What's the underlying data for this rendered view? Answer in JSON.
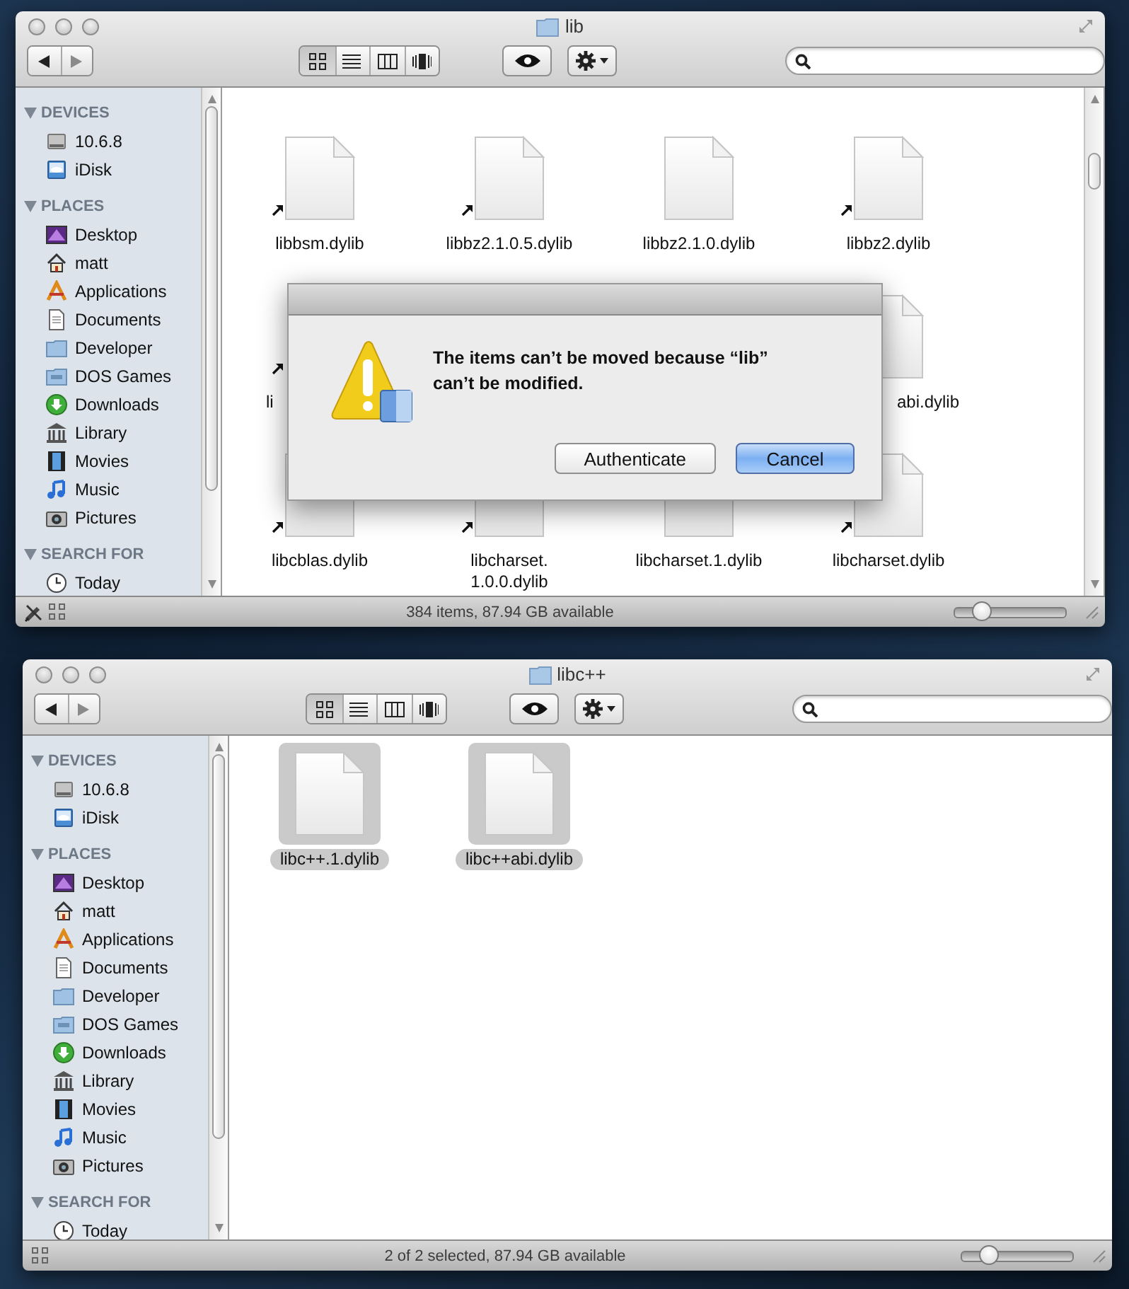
{
  "windows": [
    {
      "title": "lib",
      "scrolled": true,
      "view_modes": [
        {
          "kind": "icon",
          "selected": true
        },
        {
          "kind": "list",
          "selected": false
        },
        {
          "kind": "columns",
          "selected": false
        },
        {
          "kind": "coverflow",
          "selected": false
        }
      ],
      "sidebar": [
        {
          "header": "DEVICES",
          "items": [
            {
              "kind": "disk",
              "label": "10.6.8",
              "selected": false
            },
            {
              "kind": "idisk",
              "label": "iDisk",
              "selected": false
            }
          ]
        },
        {
          "header": "PLACES",
          "items": [
            {
              "kind": "desktop",
              "label": "Desktop",
              "selected": false
            },
            {
              "kind": "home",
              "label": "matt",
              "selected": false
            },
            {
              "kind": "applications",
              "label": "Applications",
              "selected": false
            },
            {
              "kind": "documents",
              "label": "Documents",
              "selected": false
            },
            {
              "kind": "folder",
              "label": "Developer",
              "selected": false
            },
            {
              "kind": "dos-folder",
              "label": "DOS Games",
              "selected": false
            },
            {
              "kind": "downloads",
              "label": "Downloads",
              "selected": false
            },
            {
              "kind": "library",
              "label": "Library",
              "selected": false
            },
            {
              "kind": "movies",
              "label": "Movies",
              "selected": false
            },
            {
              "kind": "music",
              "label": "Music",
              "selected": false
            },
            {
              "kind": "pictures",
              "label": "Pictures",
              "selected": false
            }
          ]
        },
        {
          "header": "SEARCH FOR",
          "items": [
            {
              "kind": "clock",
              "label": "Today",
              "selected": false
            }
          ]
        }
      ],
      "files": [
        [
          {
            "name": "libbsm.dylib",
            "alias": true,
            "selected": false
          },
          {
            "name": "libbz2.1.0.5.dylib",
            "alias": true,
            "selected": false
          },
          {
            "name": "libbz2.1.0.dylib",
            "alias": false,
            "selected": false
          },
          {
            "name": "libbz2.dylib",
            "alias": true,
            "selected": false
          }
        ],
        [
          {
            "name": "li",
            "alias": true,
            "selected": false,
            "covered": true
          },
          {
            "name": "abi.dylib",
            "alias": false,
            "selected": false,
            "covered": true
          }
        ],
        [
          {
            "name": "libcblas.dylib",
            "alias": true,
            "selected": false
          },
          {
            "name": "libcharset.1.0.0.dylib",
            "alias": true,
            "selected": false
          },
          {
            "name": "libcharset.1.dylib",
            "alias": false,
            "selected": false
          },
          {
            "name": "libcharset.dylib",
            "alias": true,
            "selected": false
          }
        ]
      ],
      "status": "384 items, 87.94 GB available",
      "read_only": true,
      "zoom": {
        "level": 0.24
      },
      "alert": {
        "message": "The items can’t be moved because “lib” can’t be modified.",
        "buttons": [
          {
            "label": "Authenticate",
            "default": false
          },
          {
            "label": "Cancel",
            "default": true
          }
        ]
      }
    },
    {
      "title": "libc++",
      "scrolled": false,
      "view_modes": [
        {
          "kind": "icon",
          "selected": true
        },
        {
          "kind": "list",
          "selected": false
        },
        {
          "kind": "columns",
          "selected": false
        },
        {
          "kind": "coverflow",
          "selected": false
        }
      ],
      "sidebar": [
        {
          "header": "DEVICES",
          "items": [
            {
              "kind": "disk",
              "label": "10.6.8",
              "selected": false
            },
            {
              "kind": "idisk",
              "label": "iDisk",
              "selected": false
            }
          ]
        },
        {
          "header": "PLACES",
          "items": [
            {
              "kind": "desktop",
              "label": "Desktop",
              "selected": false
            },
            {
              "kind": "home",
              "label": "matt",
              "selected": false
            },
            {
              "kind": "applications",
              "label": "Applications",
              "selected": false
            },
            {
              "kind": "documents",
              "label": "Documents",
              "selected": false
            },
            {
              "kind": "folder",
              "label": "Developer",
              "selected": false
            },
            {
              "kind": "dos-folder",
              "label": "DOS Games",
              "selected": false
            },
            {
              "kind": "downloads",
              "label": "Downloads",
              "selected": false
            },
            {
              "kind": "library",
              "label": "Library",
              "selected": false
            },
            {
              "kind": "movies",
              "label": "Movies",
              "selected": false
            },
            {
              "kind": "music",
              "label": "Music",
              "selected": false
            },
            {
              "kind": "pictures",
              "label": "Pictures",
              "selected": false
            }
          ]
        },
        {
          "header": "SEARCH FOR",
          "items": [
            {
              "kind": "clock",
              "label": "Today",
              "selected": false
            }
          ]
        }
      ],
      "files": [
        [
          {
            "name": "libc++.1.dylib",
            "alias": false,
            "selected": true
          },
          {
            "name": "libc++abi.dylib",
            "alias": false,
            "selected": true
          }
        ]
      ],
      "status": "2 of 2 selected, 87.94 GB available",
      "read_only": false,
      "zoom": {
        "level": 0.24
      }
    }
  ]
}
